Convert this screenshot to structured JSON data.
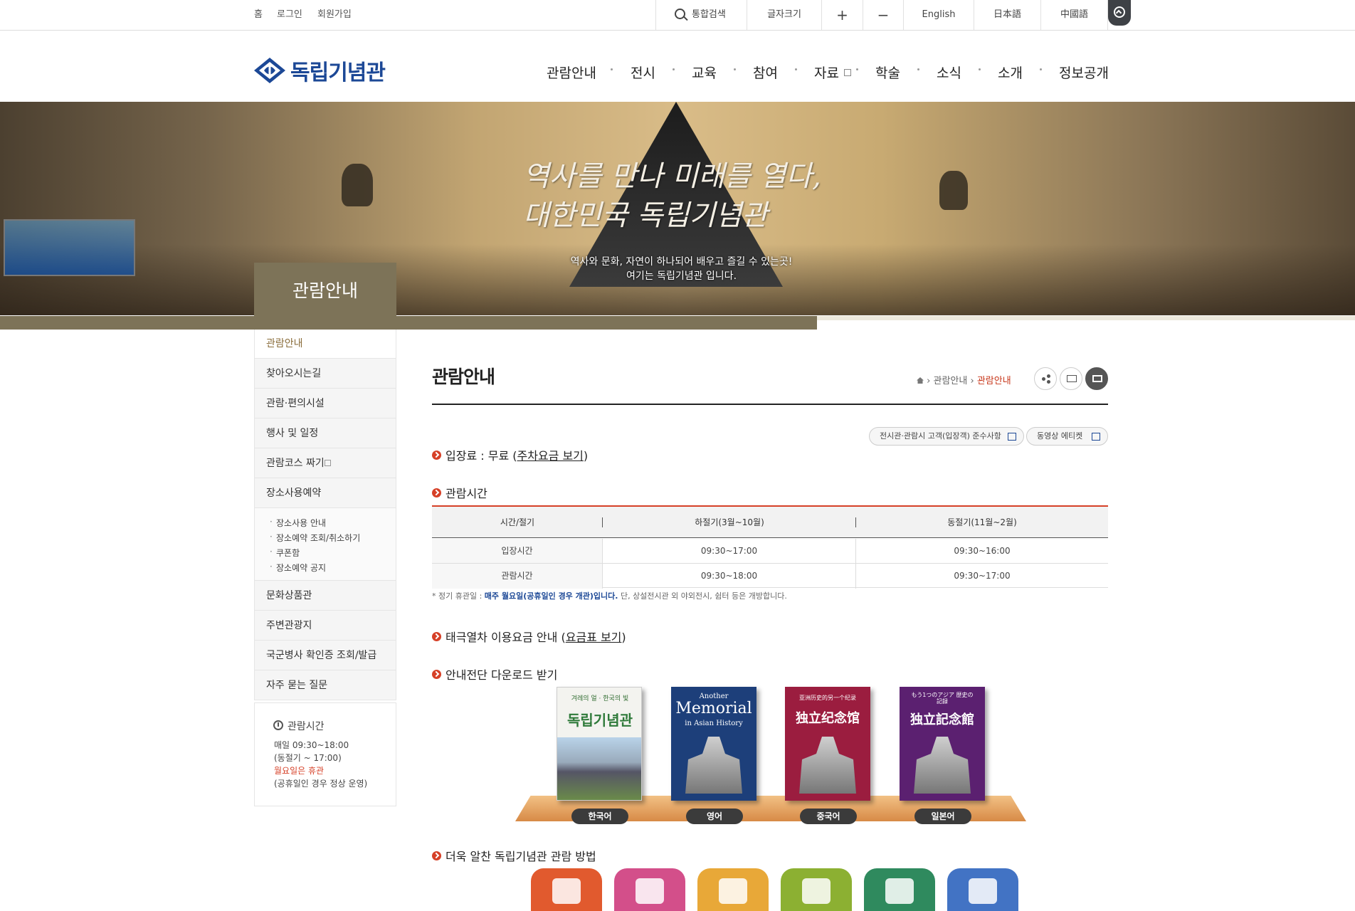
{
  "top_links": [
    "홈",
    "로그인",
    "회원가입"
  ],
  "utility": {
    "search": "통합검색",
    "font_size": "글자크기",
    "plus": "+",
    "minus": "−",
    "languages": [
      "English",
      "日本語",
      "中國語"
    ]
  },
  "logo": {
    "text": "독립기념관",
    "color": "#1c4896"
  },
  "gnb": [
    "관람안내",
    "전시",
    "교육",
    "참여",
    "자료",
    "학술",
    "소식",
    "소개",
    "정보공개"
  ],
  "banner": {
    "slogan_line1": "역사를 만나 미래를 열다,",
    "slogan_line2": "대한민국 독립기념관",
    "sub_line1": "역사와 문화, 자연이 하나되어 배우고 즐길 수 있는곳!",
    "sub_line2": "여기는 독립기념관 입니다.",
    "section_title": "관람안내"
  },
  "lnb": {
    "items": [
      "관람안내",
      "찾아오시는길",
      "관람·편의시설",
      "행사 및 일정",
      "관람코스 짜기",
      "장소사용예약",
      "문화상품관",
      "주변관광지",
      "국군병사 확인증 조회/발급",
      "자주 묻는 질문"
    ],
    "sub_items": [
      "장소사용 안내",
      "장소예약 조회/취소하기",
      "쿠폰함",
      "장소예약 공지"
    ],
    "hours_title": "관람시간",
    "hours_line1": "매일 09:30~18:00",
    "hours_line2": "(동절기 ~ 17:00)",
    "hours_line3": "월요일은 휴관",
    "hours_line4": "(공휴일인 경우 정상 운영)"
  },
  "content": {
    "title": "관람안내",
    "breadcrumb": [
      "관람안내",
      "관람안내"
    ],
    "pills": [
      "전시관·관람시 고객(입장객) 준수사항",
      "동영상 에티켓"
    ],
    "admission_label": "입장료 : 무료 (",
    "admission_link": "주차요금 보기",
    "admission_close": ")",
    "hours_heading": "관람시간",
    "table": {
      "headers": [
        "시간/절기",
        "하절기(3월~10월)",
        "동절기(11월~2월)"
      ],
      "rows": [
        [
          "입장시간",
          "09:30~17:00",
          "09:30~16:00"
        ],
        [
          "관람시간",
          "09:30~18:00",
          "09:30~17:00"
        ]
      ]
    },
    "note_prefix": "* 정기 휴관일 : ",
    "note_highlight": "매주 월요일(공휴일인 경우 개관)입니다.",
    "note_suffix": " 단, 상설전시관 외 야외전시, 쉼터 등은 개방합니다.",
    "train_label": "태극열차 이용요금 안내 (",
    "train_link": "요금표 보기",
    "train_close": ")",
    "download_heading": "안내전단 다운로드 받기",
    "books": [
      {
        "top": "겨레의 얼 · 한국의 빛",
        "title": "독립기념관",
        "label": "한국어",
        "color": "#f3f3ef"
      },
      {
        "top": "Another",
        "title": "Memorial",
        "sub": "in Asian History",
        "label": "영어",
        "color": "#1d3f7a"
      },
      {
        "top": "亚洲历史的另一个纪录",
        "title": "独立纪念馆",
        "label": "중국어",
        "color": "#9b1d3f"
      },
      {
        "top": "もう1つのアジア 歴史の記録",
        "title": "独立記念館",
        "label": "일본어",
        "color": "#5b2070"
      }
    ],
    "more_heading": "더욱 알찬 독립기념관 관람 방법",
    "tiles": [
      "#e15a2e",
      "#d34f8a",
      "#e8a838",
      "#8cb032",
      "#2f8a5e",
      "#4273c4"
    ]
  },
  "colors": {
    "accent": "#d64027",
    "band": "#7d7358",
    "brand": "#1c4896"
  }
}
